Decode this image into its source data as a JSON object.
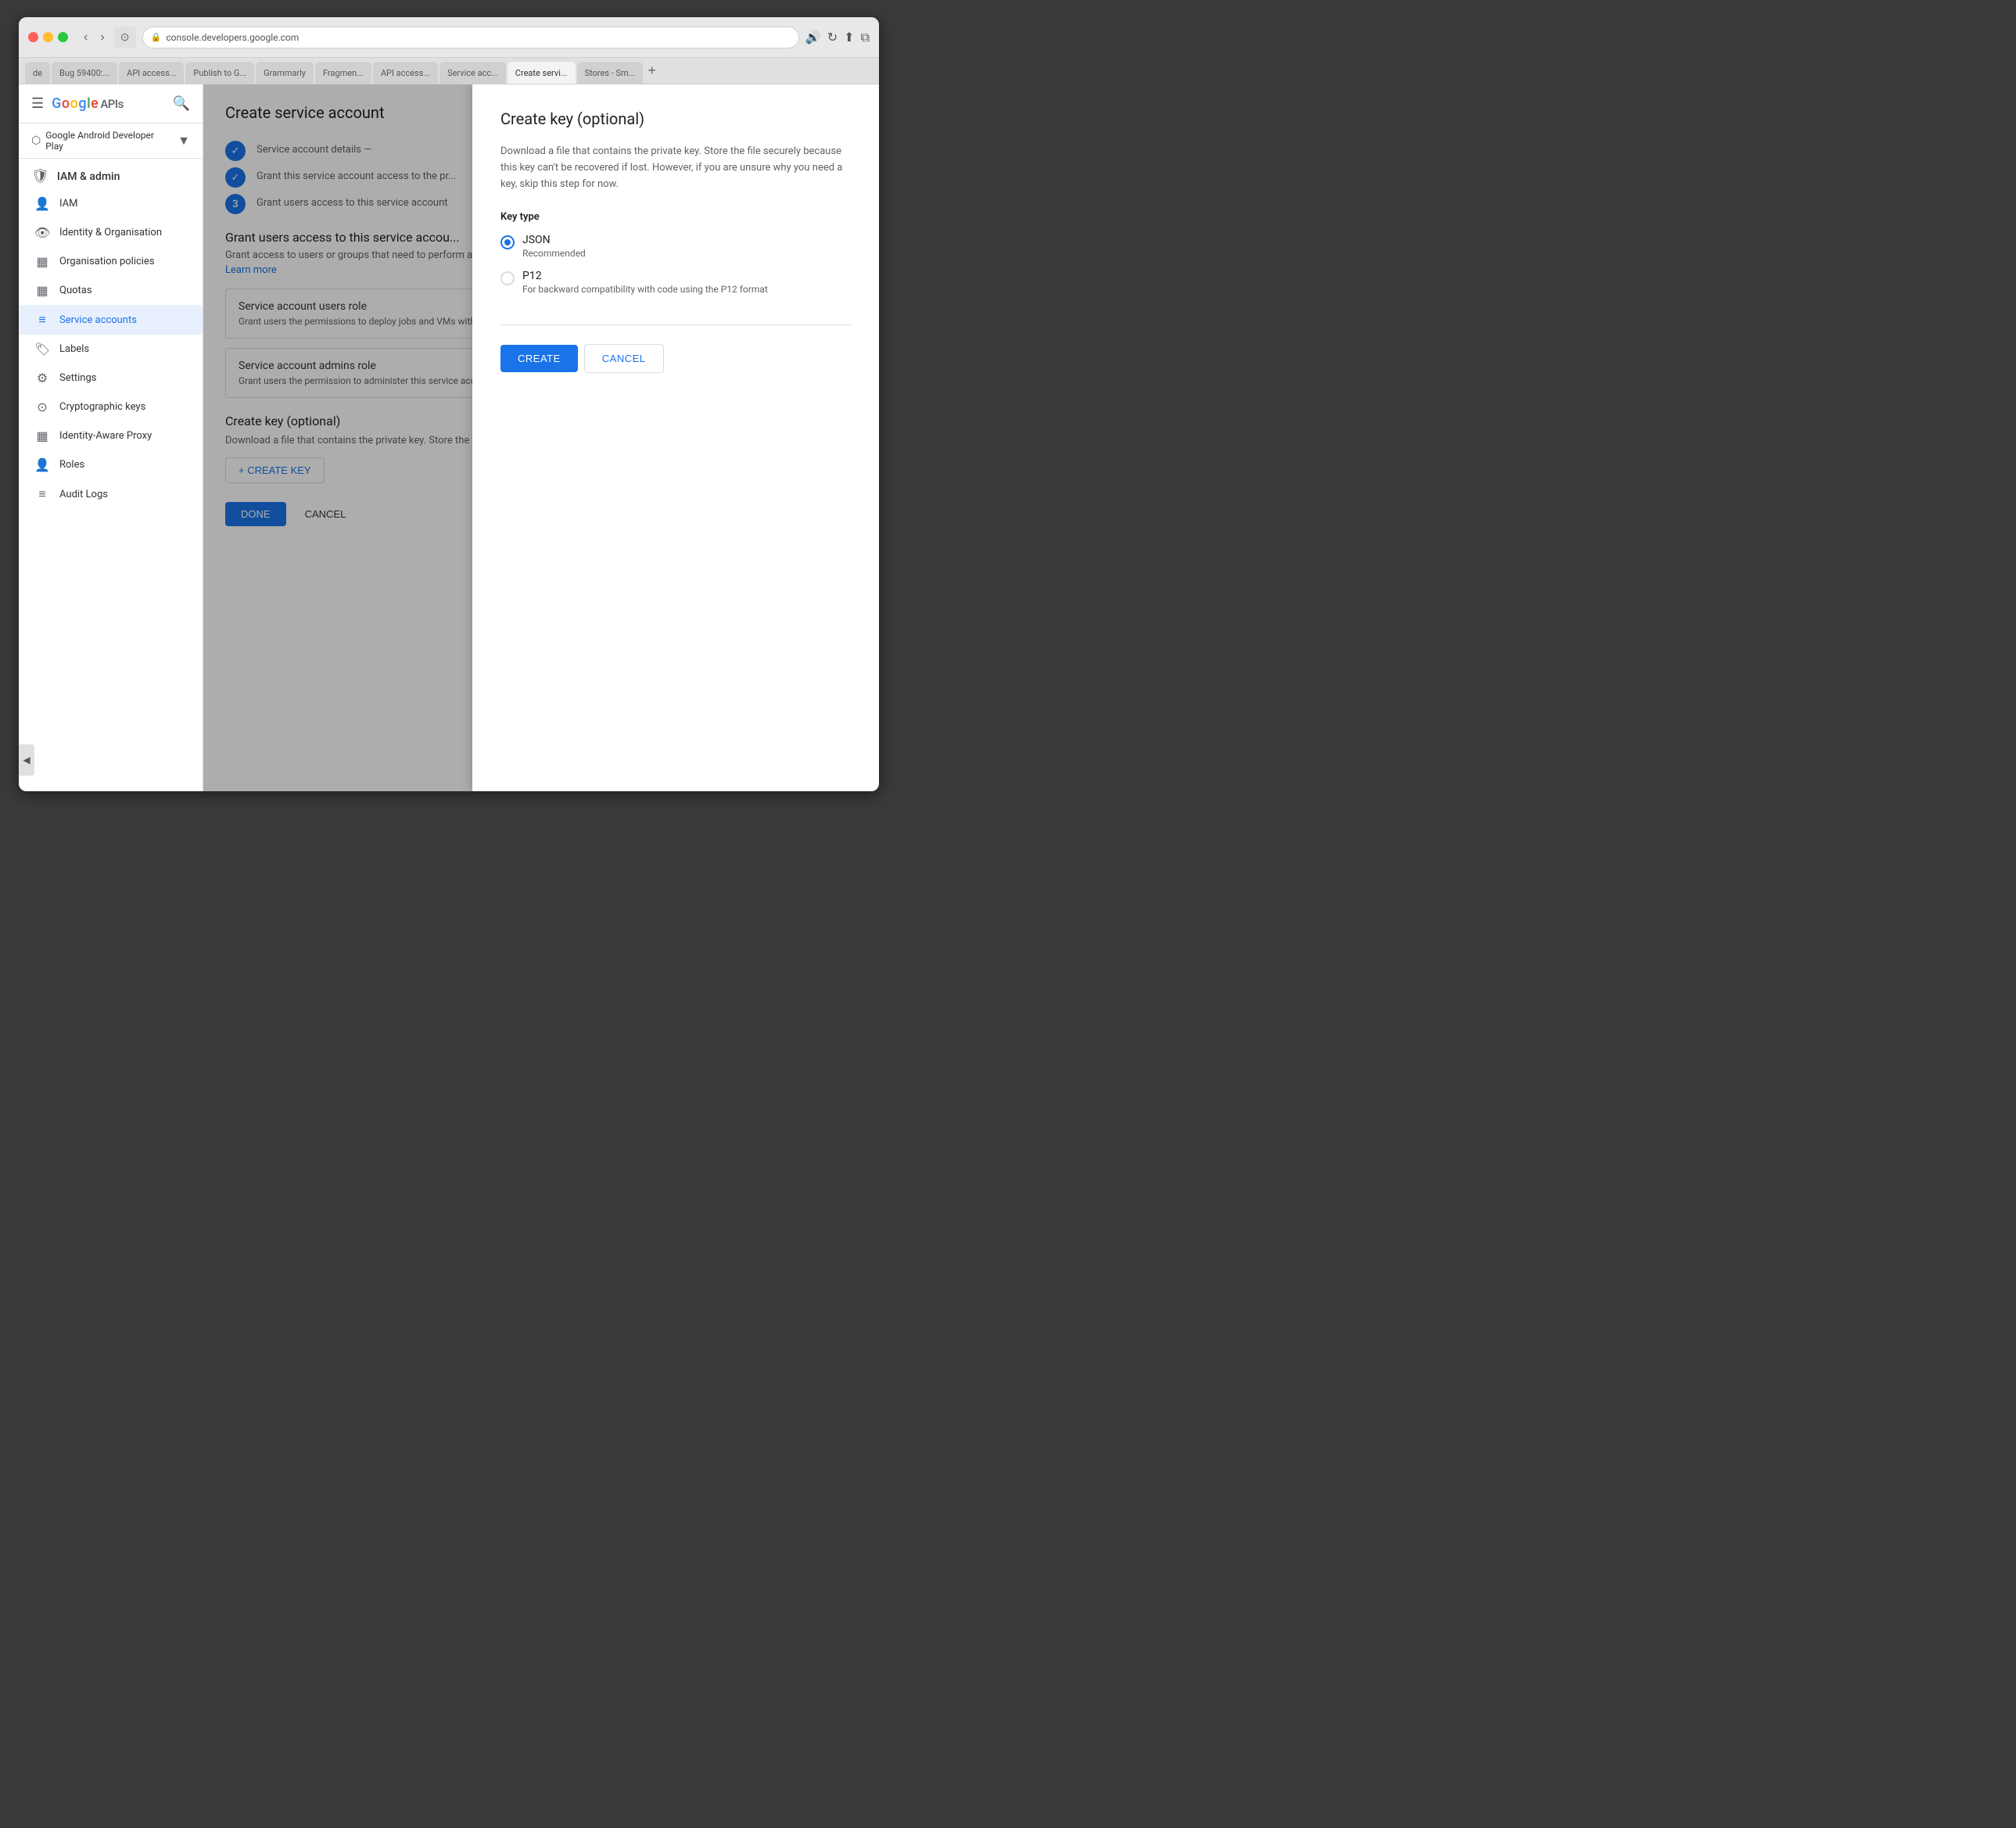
{
  "browser": {
    "title_bar": {
      "back_btn": "‹",
      "forward_btn": "›",
      "page_icon": "⊙",
      "address": "console.developers.google.com",
      "lock_icon": "🔒",
      "sound_icon": "🔊",
      "reload_icon": "↻",
      "share_icon": "⬆",
      "new_window_icon": "⧉"
    },
    "tabs": [
      {
        "label": "de",
        "active": false
      },
      {
        "label": "Bug 59400:...",
        "active": false
      },
      {
        "label": "API access...",
        "active": false
      },
      {
        "label": "Publish to G...",
        "active": false
      },
      {
        "label": "Grammarly",
        "active": false
      },
      {
        "label": "Fragmen...",
        "active": false
      },
      {
        "label": "API access...",
        "active": false
      },
      {
        "label": "Service acc...",
        "active": false
      },
      {
        "label": "Create servi...",
        "active": true
      },
      {
        "label": "Stores - Sm...",
        "active": false
      }
    ],
    "tab_new": "+"
  },
  "sidebar": {
    "hamburger": "☰",
    "logo": {
      "g": "G",
      "o1": "o",
      "o2": "o",
      "g2": "g",
      "l": "l",
      "e": "e",
      "apis": "APIs"
    },
    "project": {
      "icon": "⬡",
      "name": "Google Android Developer Play",
      "dropdown": "▼"
    },
    "section": {
      "icon": "🛡",
      "label": "IAM & admin"
    },
    "nav_items": [
      {
        "id": "iam",
        "icon": "👤",
        "label": "IAM",
        "active": false
      },
      {
        "id": "identity-org",
        "icon": "👁",
        "label": "Identity & Organisation",
        "active": false
      },
      {
        "id": "org-policies",
        "icon": "▦",
        "label": "Organisation policies",
        "active": false
      },
      {
        "id": "quotas",
        "icon": "▦",
        "label": "Quotas",
        "active": false
      },
      {
        "id": "service-accounts",
        "icon": "≡",
        "label": "Service accounts",
        "active": true
      },
      {
        "id": "labels",
        "icon": "🏷",
        "label": "Labels",
        "active": false
      },
      {
        "id": "settings",
        "icon": "⚙",
        "label": "Settings",
        "active": false
      },
      {
        "id": "crypto-keys",
        "icon": "⊙",
        "label": "Cryptographic keys",
        "active": false
      },
      {
        "id": "identity-proxy",
        "icon": "▦",
        "label": "Identity-Aware Proxy",
        "active": false
      },
      {
        "id": "roles",
        "icon": "👤",
        "label": "Roles",
        "active": false
      },
      {
        "id": "audit-logs",
        "icon": "≡",
        "label": "Audit Logs",
        "active": false
      }
    ],
    "collapse_btn": "◀"
  },
  "main_panel": {
    "title": "Create service account",
    "steps": [
      {
        "num": "✓",
        "label": "Service account details —",
        "completed": true
      },
      {
        "num": "✓",
        "label": "Grant this service account access to the pr...",
        "completed": true
      },
      {
        "num": "3",
        "label": "Grant users access to this service account",
        "active": true
      }
    ],
    "section_title": "Grant users access to this service accou...",
    "section_desc": "Grant access to users or groups that need to perform ac...",
    "learn_more": "Learn more",
    "roles": [
      {
        "title": "Service account users role",
        "desc": "Grant users the permissions to deploy jobs and VMs with th..."
      },
      {
        "title": "Service account admins role",
        "desc": "Grant users the permission to administer this service acco..."
      }
    ],
    "create_key": {
      "title": "Create key (optional)",
      "desc": "Download a file that contains the private key. Store the fi... can't be recovered if lost. However, if you are unsure why... for now.",
      "btn_label": "+ CREATE KEY"
    },
    "bottom": {
      "done": "DONE",
      "cancel": "CANCEL"
    }
  },
  "dialog": {
    "title": "Create key (optional)",
    "desc": "Download a file that contains the private key. Store the file securely because this key can't be recovered if lost. However, if you are unsure why you need a key, skip this step for now.",
    "key_type_label": "Key type",
    "options": [
      {
        "id": "json",
        "label": "JSON",
        "sublabel": "Recommended",
        "selected": true
      },
      {
        "id": "p12",
        "label": "P12",
        "sublabel": "For backward compatibility with code using the P12 format",
        "selected": false
      }
    ],
    "actions": {
      "create": "CREATE",
      "cancel": "CANCEL"
    }
  }
}
